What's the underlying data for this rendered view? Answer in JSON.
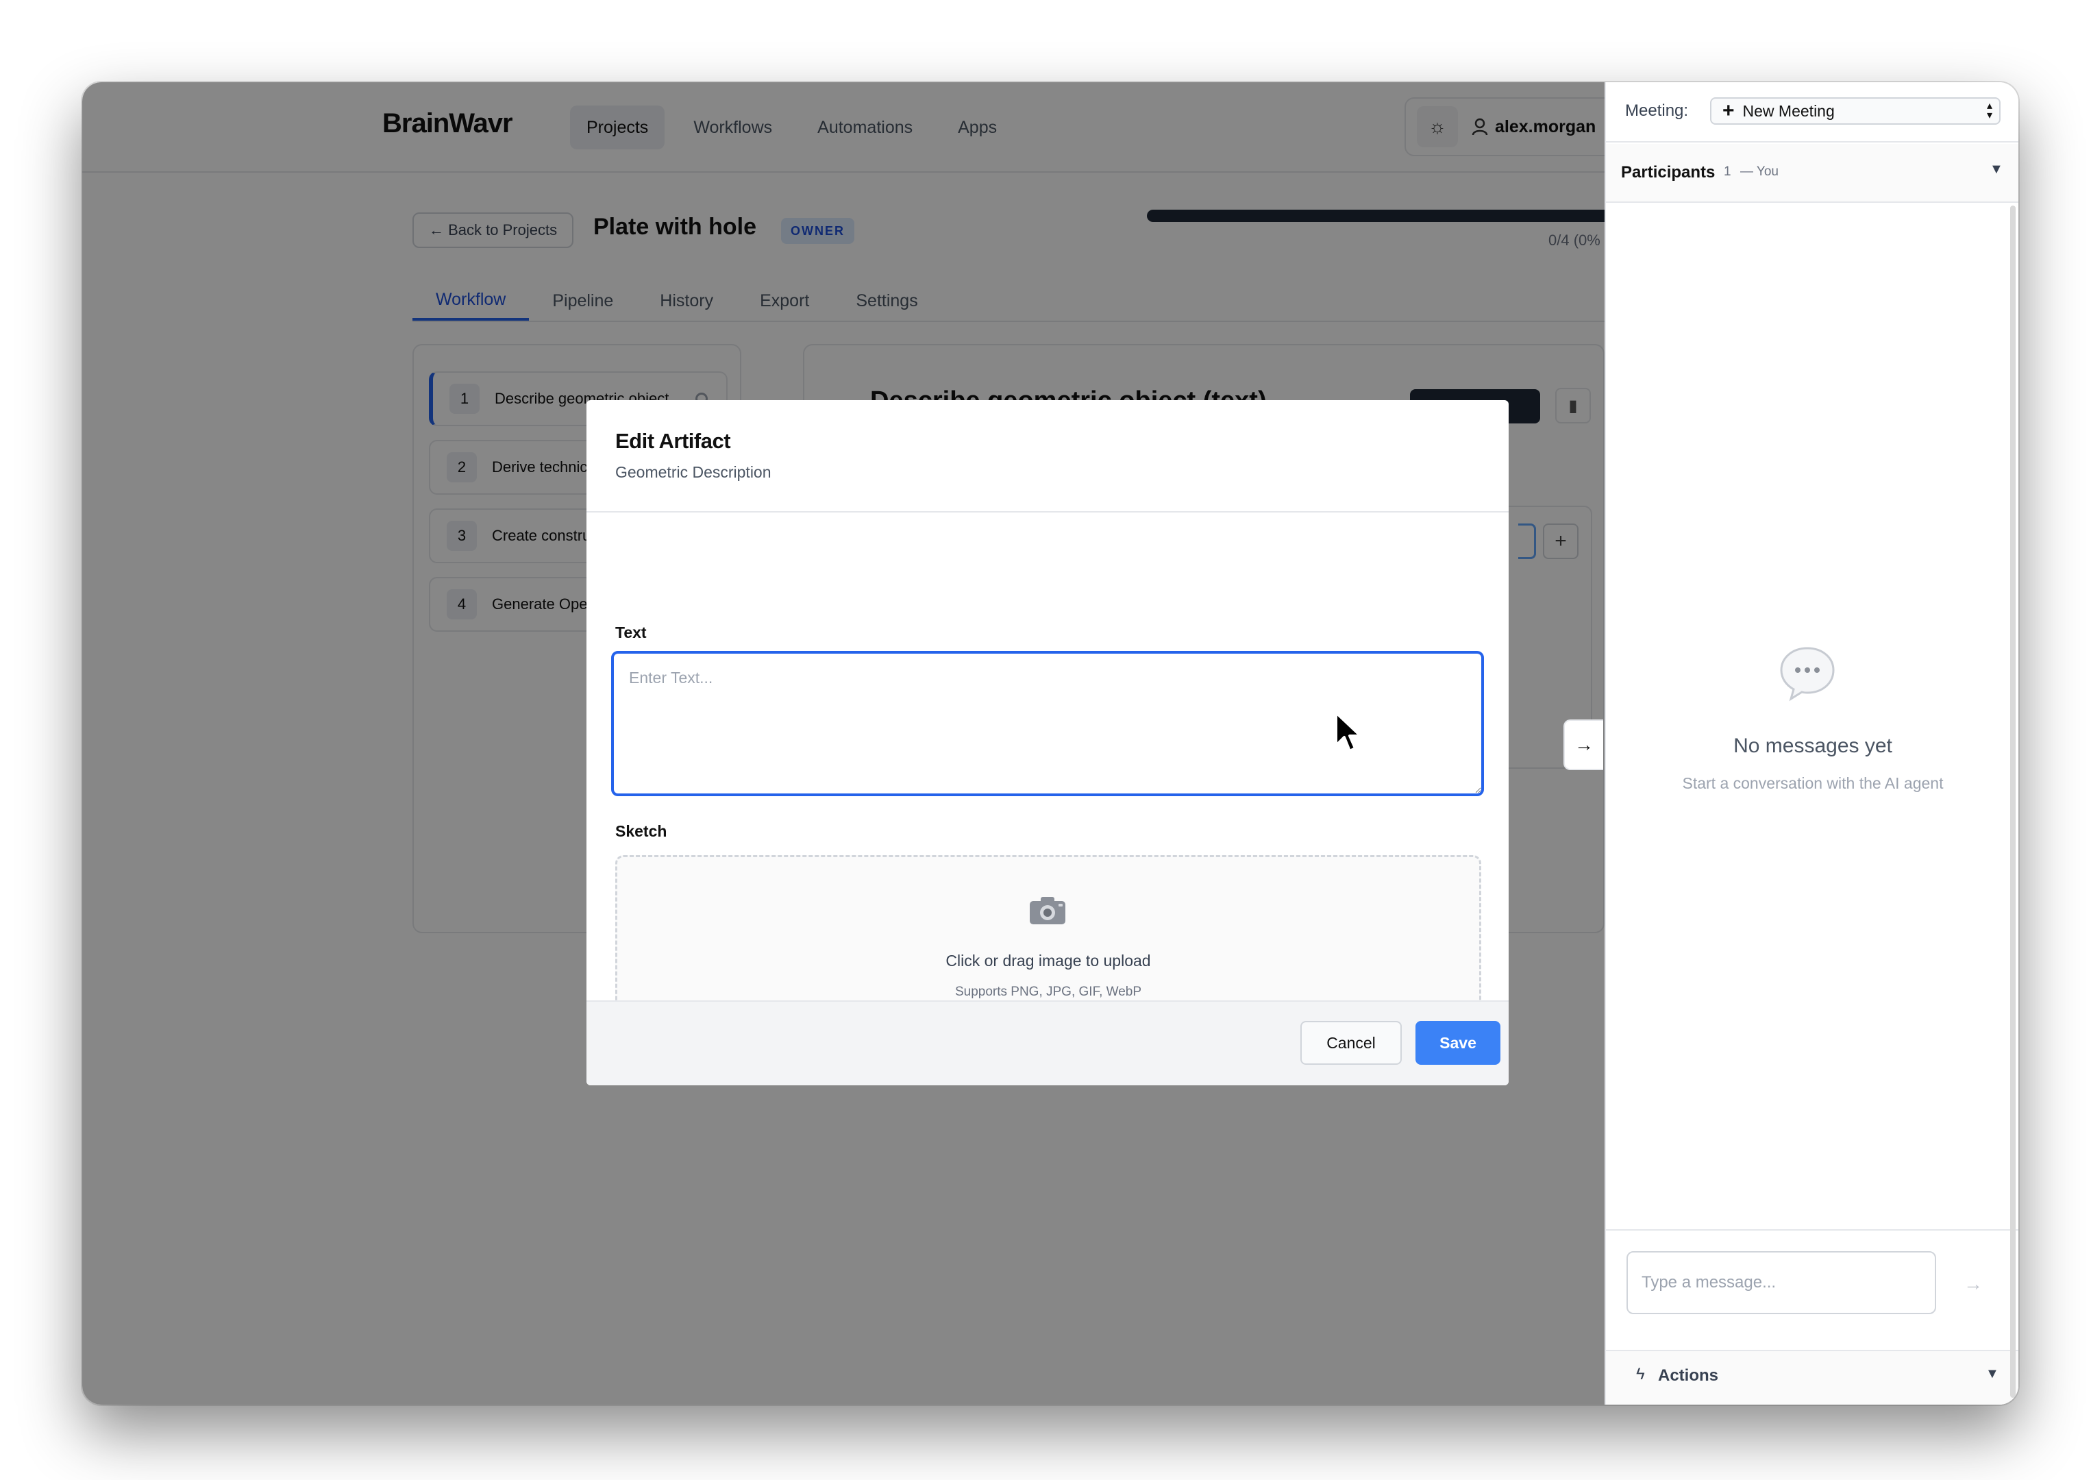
{
  "app": {
    "brand": "BrainWavr",
    "nav": [
      "Projects",
      "Workflows",
      "Automations",
      "Apps"
    ],
    "active_nav": "Projects",
    "user": "alex.morgan",
    "theme_icon": "sun-icon"
  },
  "project": {
    "back_label": "← Back to Projects",
    "title": "Plate with hole",
    "badge": "OWNER",
    "progress_text": "0/4 (0%",
    "progress_fraction": 0.0
  },
  "tabs": [
    "Workflow",
    "Pipeline",
    "History",
    "Export",
    "Settings"
  ],
  "active_tab": "Workflow",
  "steps": [
    {
      "num": "1",
      "label": "Describe geometric object ..."
    },
    {
      "num": "2",
      "label": "Derive technica"
    },
    {
      "num": "3",
      "label": "Create constru"
    },
    {
      "num": "4",
      "label": "Generate Oper"
    }
  ],
  "main": {
    "heading": "Describe geometric object (text)"
  },
  "modal": {
    "title": "Edit Artifact",
    "subtitle": "Geometric Description",
    "text_label": "Text",
    "text_placeholder": "Enter Text...",
    "text_value": "",
    "sketch_label": "Sketch",
    "upload_main": "Click or drag image to upload",
    "upload_sub": "Supports PNG, JPG, GIF, WebP",
    "cancel_label": "Cancel",
    "save_label": "Save",
    "accent_color": "#3b82f6"
  },
  "sidebar": {
    "meeting_label": "Meeting:",
    "meeting_value": "New Meeting",
    "participants_label": "Participants",
    "participants_count": "1",
    "participants_you": "— You",
    "empty_title": "No messages yet",
    "empty_subtitle": "Start a conversation with the AI agent",
    "message_placeholder": "Type a message...",
    "actions_label": "Actions"
  }
}
